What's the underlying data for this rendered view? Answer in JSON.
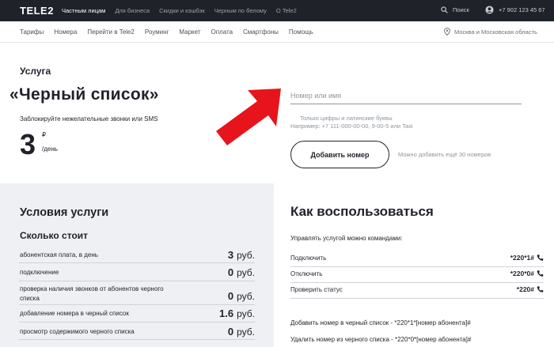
{
  "topbar": {
    "logo": "TELE2",
    "nav": [
      "Частным лицам",
      "Для бизнеса",
      "Скидки и кэшбэк",
      "Черным по белому",
      "О Tele2"
    ],
    "search_label": "Поиск",
    "phone": "+7 902 123 45 67"
  },
  "subnav": {
    "items": [
      "Тарифы",
      "Номера",
      "Перейти в Tele2",
      "Роуминг",
      "Маркет",
      "Оплата",
      "Смартфоны",
      "Помощь"
    ],
    "region": "Москва и Московская область"
  },
  "service": {
    "kicker": "Услуга",
    "title": "«Черный список»",
    "description": "Заблокируйте нежелательные звонки или SMS",
    "price": "3",
    "currency": "₽",
    "per": "/день"
  },
  "form": {
    "placeholder": "Номер или имя",
    "hint1": "Только цифры и латинские буквы",
    "hint2": "Например: +7 111-000-00-00, 9-00-5 или Taxi",
    "button": "Добавить номер",
    "note": "Можно добавить ещё 30 номеров"
  },
  "conditions": {
    "title": "Условия услуги",
    "subtitle": "Сколько стоит",
    "rows": [
      {
        "label": "абонентская плата, в день",
        "value": "3",
        "unit": "руб."
      },
      {
        "label": "подключение",
        "value": "0",
        "unit": "руб."
      },
      {
        "label": "проверка наличия звонков от абонентов черного списка",
        "value": "0",
        "unit": "руб."
      },
      {
        "label": "добавление номера в черный список",
        "value": "1.6",
        "unit": "руб."
      },
      {
        "label": "просмотр содержимого черного списка",
        "value": "0",
        "unit": "руб."
      }
    ]
  },
  "howto": {
    "title": "Как воспользоваться",
    "intro": "Управлять услугой можно командами:",
    "commands": [
      {
        "label": "Подключить",
        "code": "*220*1#"
      },
      {
        "label": "Отключить",
        "code": "*220*0#"
      },
      {
        "label": "Проверить статус",
        "code": "*220#"
      }
    ],
    "add_text": "Добавить номер в черный список - *220*1*[номер абонента]#",
    "remove_text": "Удалить номер из черного списка - *220*0*[номер абонента]#"
  },
  "colors": {
    "dark": "#1f2229",
    "arrow": "#e8141b",
    "panel": "#eef0f3"
  }
}
